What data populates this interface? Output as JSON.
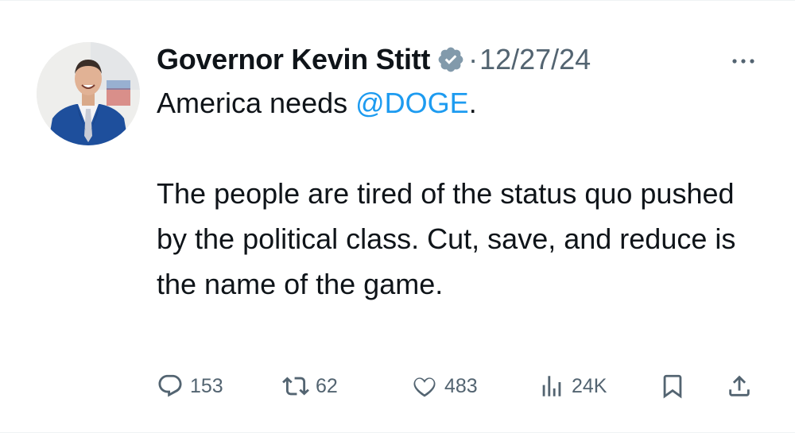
{
  "tweet": {
    "author": {
      "display_name": "Governor Kevin Stitt",
      "verified_icon": "verified-badge-icon"
    },
    "separator": "·",
    "date": "12/27/24",
    "body": {
      "line1_prefix": "America needs ",
      "mention": "@DOGE",
      "line1_suffix": ".",
      "paragraph2": "The people are tired of the status quo pushed by the political class. Cut, save, and reduce is the name of the game."
    },
    "actions": {
      "replies": "153",
      "reposts": "62",
      "likes": "483",
      "views": "24K"
    },
    "colors": {
      "accent": "#1d9bf0",
      "muted": "#536471",
      "verified_gray": "#829aab",
      "text": "#0f1419"
    }
  }
}
